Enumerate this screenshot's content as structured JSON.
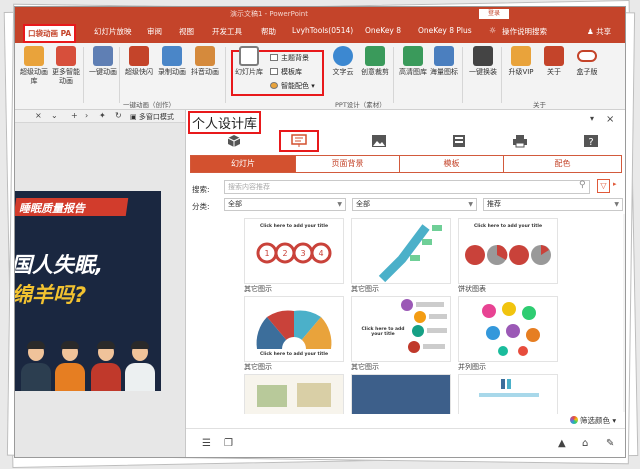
{
  "window": {
    "title": "演示文稿1 - PowerPoint",
    "signin": "登录",
    "share": "共享"
  },
  "tabs": [
    {
      "label": "口袋动画 PA"
    },
    {
      "label": "幻灯片放映"
    },
    {
      "label": "审阅"
    },
    {
      "label": "视图"
    },
    {
      "label": "开发工具"
    },
    {
      "label": "帮助"
    },
    {
      "label": "LvyhTools(0514)"
    },
    {
      "label": "OneKey 8"
    },
    {
      "label": "OneKey 8 Plus"
    },
    {
      "label": "操作说明搜索"
    }
  ],
  "ribbon": {
    "buttons": [
      {
        "label": "超级动画库",
        "icon": "star-icon",
        "color": "#e9a33b"
      },
      {
        "label": "更多智能动画",
        "icon": "cube-icon",
        "color": "#d74f3b"
      },
      {
        "label": "一键动画",
        "icon": "wand-icon",
        "color": "#5f7fb4"
      },
      {
        "label": "超级快闪",
        "icon": "flash-icon",
        "color": "#c4442a"
      },
      {
        "label": "录制动画",
        "icon": "record-icon",
        "color": "#4a86c8"
      },
      {
        "label": "抖音动画",
        "icon": "monkey-icon",
        "color": "#d58a3c"
      },
      {
        "label": "幻灯片库",
        "icon": "slides-icon",
        "color": "#7d7d7d"
      },
      {
        "label": "文字云",
        "icon": "cloud-icon",
        "color": "#3c88d1"
      },
      {
        "label": "创意裁剪",
        "icon": "crop-icon",
        "color": "#3a9a5b"
      },
      {
        "label": "高清图库",
        "icon": "gallery-icon",
        "color": "#3a9a5b"
      },
      {
        "label": "海量图标",
        "icon": "icons-icon",
        "color": "#4b7fbf"
      },
      {
        "label": "一键换装",
        "icon": "shirt-icon",
        "color": "#444444"
      },
      {
        "label": "升级VIP",
        "icon": "vip-icon",
        "color": "#e9a33b"
      },
      {
        "label": "关于",
        "icon": "about-icon",
        "color": "#c4442a"
      },
      {
        "label": "盒子版",
        "icon": "toggle-icon",
        "color": "#c4442a"
      }
    ],
    "small_items": [
      "主题背景",
      "模板库",
      "智能配色"
    ],
    "groups": [
      "一键动画（创作）",
      "PPT设计（素材）",
      "关于"
    ]
  },
  "leftbar": {
    "multi_window": "多窗口模式"
  },
  "slide": {
    "title": "睡眠质量报告",
    "line1": "国人失眠,",
    "line2": "绵羊吗?"
  },
  "panel": {
    "title": "个人设计库",
    "subtabs": [
      "幻灯片",
      "页面背景",
      "模板",
      "配色"
    ],
    "search_label": "搜索:",
    "search_placeholder": "搜索内容推荐",
    "class_label": "分类:",
    "filters": [
      "全部",
      "全部",
      "推荐"
    ],
    "cards": [
      {
        "caption": "其它图示",
        "thumb_title": "Click here to add your title"
      },
      {
        "caption": "其它图示",
        "thumb_title": ""
      },
      {
        "caption": "饼状图表",
        "thumb_title": "Click here to add your title"
      },
      {
        "caption": "其它图示",
        "thumb_title": "Click here to add your title"
      },
      {
        "caption": "其它图示",
        "thumb_title": "Click here to add your title"
      },
      {
        "caption": "并列图示",
        "thumb_title": ""
      },
      {
        "caption": "",
        "thumb_title": ""
      },
      {
        "caption": "",
        "thumb_title": ""
      },
      {
        "caption": "",
        "thumb_title": ""
      }
    ],
    "pick_color": "筛选颜色"
  },
  "colors": {
    "accent": "#c4442a",
    "highlight": "#e8191b"
  }
}
